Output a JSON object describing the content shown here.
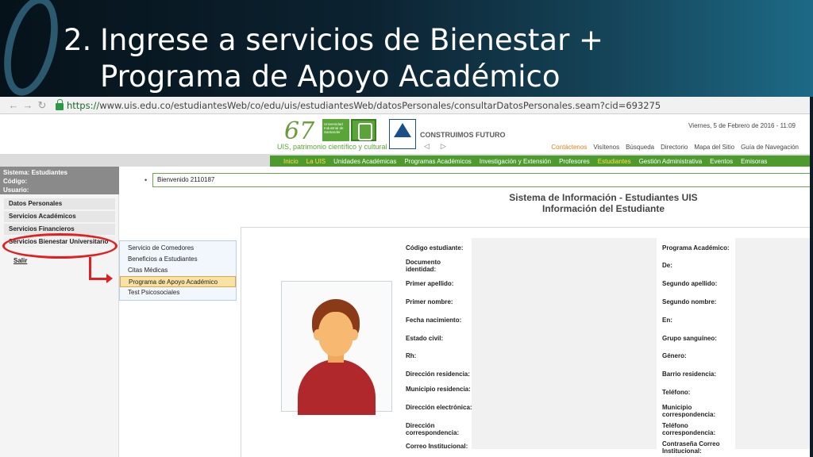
{
  "slide": {
    "number": "2.",
    "title_line1": "Ingrese a servicios de Bienestar +",
    "title_line2": "Programa de Apoyo Académico"
  },
  "browser": {
    "url_scheme": "https://",
    "url_rest": "www.uis.edu.co/estudiantesWeb/co/edu/uis/estudiantesWeb/datosPersonales/consultarDatosPersonales.seam?cid=693275",
    "back_icon": "back-arrow-icon",
    "forward_icon": "forward-arrow-icon",
    "reload_icon": "reload-icon"
  },
  "site": {
    "logo_number": "67",
    "tagline": "UIS, patrimonio científico y cultural",
    "logo_text": "Universidad Industrial de Santander",
    "construimos": "CONSTRUIMOS FUTURO",
    "date": "Viernes, 5 de Febrero de 2016 - 11:09",
    "top_links": [
      "Contáctenos",
      "Visítenos",
      "Búsqueda",
      "Directorio",
      "Mapa del Sitio",
      "Guía de Navegación"
    ],
    "menu": [
      "Inicio",
      "La UIS",
      "Unidades Académicas",
      "Programas Académicos",
      "Investigación y Extensión",
      "Profesores",
      "Estudiantes",
      "Gestión Administrativa",
      "Eventos",
      "Emisoras"
    ]
  },
  "left": {
    "sistema": "Sistema: Estudiantes",
    "codigo": "Código:",
    "usuario": "Usuario:",
    "menu": [
      "Datos Personales",
      "Servicios Académicos",
      "Servicios Financieros",
      "Servicios Bienestar Universitario"
    ],
    "salir": "Salir"
  },
  "submenu": [
    "Servicio de Comedores",
    "Beneficios a Estudiantes",
    "Citas Médicas",
    "Programa de Apoyo Académico",
    "Test Psicosociales"
  ],
  "main": {
    "welcome": "Bienvenido 2110187",
    "sys_title1": "Sistema de Información - Estudiantes UIS",
    "sys_title2": "Información del Estudiante",
    "fields_left": [
      "Código estudiante:",
      "Documento identidad:",
      "Primer apellido:",
      "Primer nombre:",
      "Fecha nacimiento:",
      "Estado civil:",
      "Rh:",
      "Dirección residencia:",
      "Municipio residencia:",
      "Dirección electrónica:",
      "Dirección correspondencia:",
      "Correo Institucional:"
    ],
    "fields_right": [
      "Programa Académico:",
      "De:",
      "Segundo apellido:",
      "Segundo nombre:",
      "En:",
      "Grupo sanguíneo:",
      "Género:",
      "Barrio residencia:",
      "Teléfono:",
      "Municipio correspondencia:",
      "Teléfono correspondencia:",
      "Contraseña Correo Institucional:"
    ]
  }
}
